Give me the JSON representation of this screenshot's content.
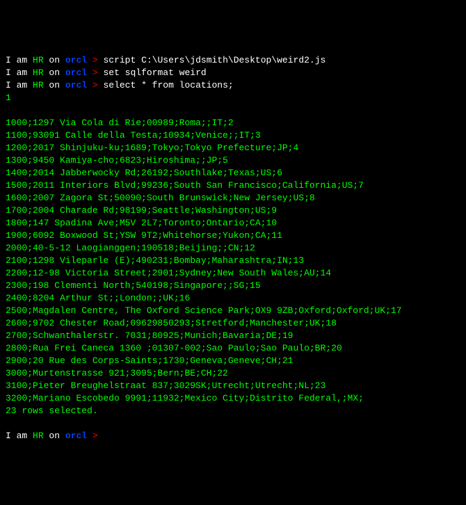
{
  "prompts": {
    "prefix": "I am ",
    "user": "HR",
    "on": " on ",
    "db": "orcl",
    "gt": " > "
  },
  "commands": {
    "cmd0": "script C:\\Users\\jdsmith\\Desktop\\weird2.js",
    "cmd1": "set sqlformat weird",
    "cmd2": "select * from locations;",
    "cmd3": ""
  },
  "output_header": "1",
  "rows": [
    "1000;1297 Via Cola di Rie;00989;Roma;;IT;2",
    "1100;93091 Calle della Testa;10934;Venice;;IT;3",
    "1200;2017 Shinjuku-ku;1689;Tokyo;Tokyo Prefecture;JP;4",
    "1300;9450 Kamiya-cho;6823;Hiroshima;;JP;5",
    "1400;2014 Jabberwocky Rd;26192;Southlake;Texas;US;6",
    "1500;2011 Interiors Blvd;99236;South San Francisco;California;US;7",
    "1600;2007 Zagora St;50090;South Brunswick;New Jersey;US;8",
    "1700;2004 Charade Rd;98199;Seattle;Washington;US;9",
    "1800;147 Spadina Ave;M5V 2L7;Toronto;Ontario;CA;10",
    "1900;6092 Boxwood St;YSW 9T2;Whitehorse;Yukon;CA;11",
    "2000;40-5-12 Laogianggen;190518;Beijing;;CN;12",
    "2100;1298 Vileparle (E);490231;Bombay;Maharashtra;IN;13",
    "2200;12-98 Victoria Street;2901;Sydney;New South Wales;AU;14",
    "2300;198 Clementi North;540198;Singapore;;SG;15",
    "2400;8204 Arthur St;;London;;UK;16",
    "2500;Magdalen Centre, The Oxford Science Park;OX9 9ZB;Oxford;Oxford;UK;17",
    "2600;9702 Chester Road;09629850293;Stretford;Manchester;UK;18",
    "2700;Schwanthalerstr. 7031;80925;Munich;Bavaria;DE;19",
    "2800;Rua Frei Caneca 1360 ;01307-002;Sao Paulo;Sao Paulo;BR;20",
    "2900;20 Rue des Corps-Saints;1730;Geneva;Geneve;CH;21",
    "3000;Murtenstrasse 921;3095;Bern;BE;CH;22",
    "3100;Pieter Breughelstraat 837;3029SK;Utrecht;Utrecht;NL;23",
    "3200;Mariano Escobedo 9991;11932;Mexico City;Distrito Federal,;MX;"
  ],
  "footer": "23 rows selected."
}
